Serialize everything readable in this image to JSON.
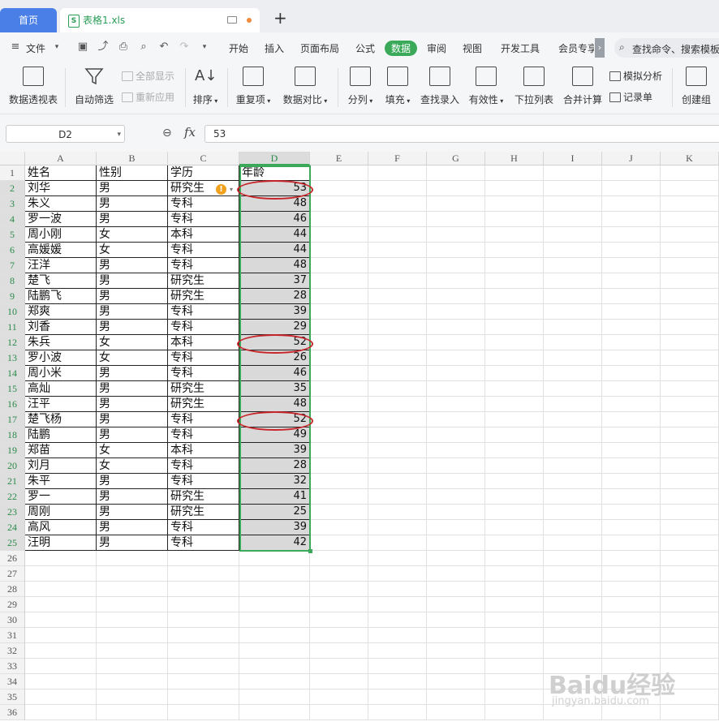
{
  "tabs": {
    "home": "首页",
    "doc": "表格1.xls",
    "doc_icon": "S",
    "new_tab": "+"
  },
  "menu": {
    "file": "文件",
    "items": [
      "开始",
      "插入",
      "页面布局",
      "公式",
      "数据",
      "审阅",
      "视图",
      "开发工具",
      "会员专享"
    ],
    "active": "数据",
    "more": "›",
    "search_placeholder": "查找命令、搜索模板"
  },
  "ribbon": {
    "pivot": "数据透视表",
    "autofilter": "自动筛选",
    "show_all": "全部显示",
    "reapply": "重新应用",
    "sort": "排序",
    "duplicates": "重复项",
    "compare": "数据对比",
    "split": "分列",
    "fill": "填充",
    "lookup": "查找录入",
    "validity": "有效性",
    "dropdown_list": "下拉列表",
    "consolidate": "合并计算",
    "simulate": "模拟分析",
    "record": "记录单",
    "create_group": "创建组"
  },
  "formula_bar": {
    "name_box": "D2",
    "fx": "fx",
    "value": "53"
  },
  "columns": [
    "A",
    "B",
    "C",
    "D",
    "E",
    "F",
    "G",
    "H",
    "I",
    "J",
    "K"
  ],
  "row_numbers": [
    "1",
    "2",
    "3",
    "4",
    "5",
    "6",
    "7",
    "8",
    "9",
    "10",
    "11",
    "12",
    "13",
    "14",
    "15",
    "16",
    "17",
    "18",
    "19",
    "20",
    "21",
    "22",
    "23",
    "24",
    "25",
    "26",
    "27",
    "28",
    "29",
    "30",
    "31",
    "32",
    "33",
    "34",
    "35",
    "36"
  ],
  "table": {
    "headers": [
      "姓名",
      "性别",
      "学历",
      "年龄"
    ],
    "rows": [
      [
        "刘华",
        "男",
        "研究生",
        "53"
      ],
      [
        "朱义",
        "男",
        "专科",
        "48"
      ],
      [
        "罗一波",
        "男",
        "专科",
        "46"
      ],
      [
        "周小刚",
        "女",
        "本科",
        "44"
      ],
      [
        "高媛媛",
        "女",
        "专科",
        "44"
      ],
      [
        "汪洋",
        "男",
        "专科",
        "48"
      ],
      [
        "楚飞",
        "男",
        "研究生",
        "37"
      ],
      [
        "陆鹏飞",
        "男",
        "研究生",
        "28"
      ],
      [
        "郑爽",
        "男",
        "专科",
        "39"
      ],
      [
        "刘香",
        "男",
        "专科",
        "29"
      ],
      [
        "朱兵",
        "女",
        "本科",
        "52"
      ],
      [
        "罗小波",
        "女",
        "专科",
        "26"
      ],
      [
        "周小米",
        "男",
        "专科",
        "46"
      ],
      [
        "高灿",
        "男",
        "研究生",
        "35"
      ],
      [
        "汪平",
        "男",
        "研究生",
        "48"
      ],
      [
        "楚飞杨",
        "男",
        "专科",
        "52"
      ],
      [
        "陆鹏",
        "男",
        "专科",
        "49"
      ],
      [
        "郑苗",
        "女",
        "本科",
        "39"
      ],
      [
        "刘月",
        "女",
        "专科",
        "28"
      ],
      [
        "朱平",
        "男",
        "专科",
        "32"
      ],
      [
        "罗一",
        "男",
        "研究生",
        "41"
      ],
      [
        "周刚",
        "男",
        "研究生",
        "25"
      ],
      [
        "高风",
        "男",
        "专科",
        "39"
      ],
      [
        "汪明",
        "男",
        "专科",
        "42"
      ]
    ],
    "highlighted_rows": [
      "2",
      "12",
      "17"
    ]
  },
  "watermark": {
    "logo": "Baidu经验",
    "url": "jingyan.baidu.com"
  },
  "colors": {
    "accent_green": "#3aa95a",
    "highlight_red": "#c8252a",
    "home_tab_blue": "#4a7fe8"
  }
}
